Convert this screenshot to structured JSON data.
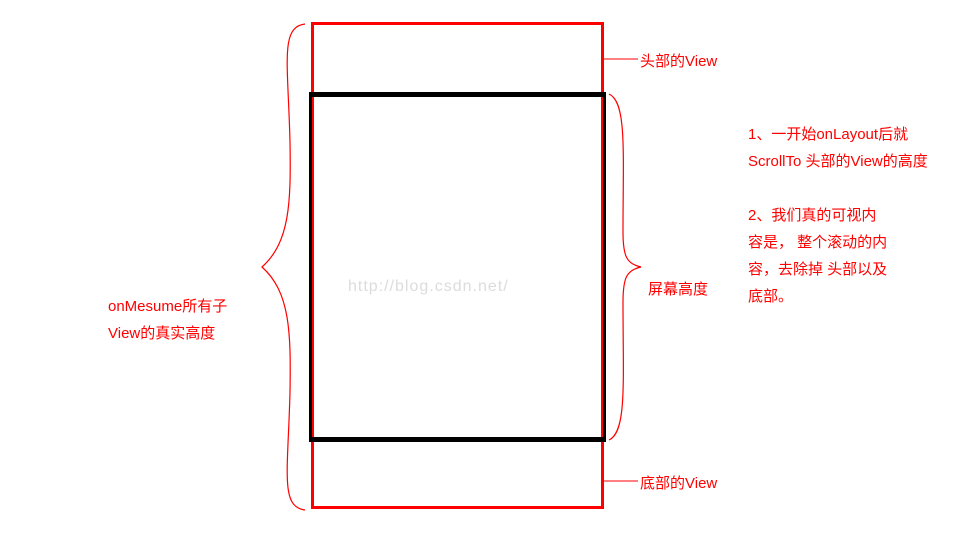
{
  "labels": {
    "header_view": "头部的View",
    "footer_view": "底部的View",
    "screen_height": "屏幕高度",
    "left_brace_line1": "onMesume所有子",
    "left_brace_line2": "View的真实高度",
    "note1_line1": "1、一开始onLayout后就",
    "note1_line2": "ScrollTo   头部的View的高度",
    "note2_line1": "2、我们真的可视内",
    "note2_line2": "容是， 整个滚动的内",
    "note2_line3": "容，去除掉 头部以及",
    "note2_line4": "底部。"
  },
  "watermark": "http://blog.csdn.net/",
  "colors": {
    "red": "#ff0000",
    "black": "#000000",
    "watermark": "#dcdcdc"
  }
}
